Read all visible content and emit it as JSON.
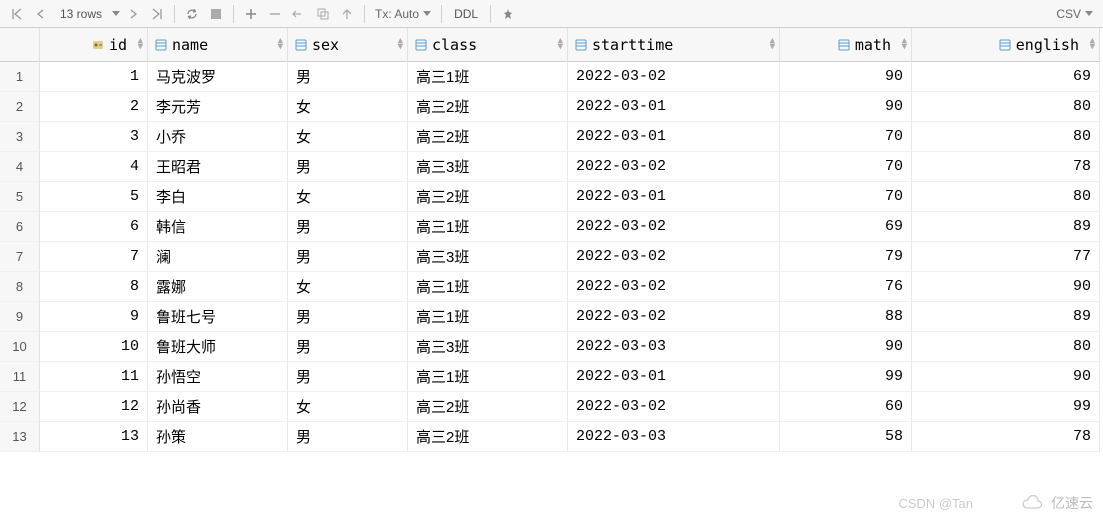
{
  "toolbar": {
    "row_count": "13 rows",
    "tx_label": "Tx: Auto",
    "ddl_label": "DDL",
    "export_label": "CSV"
  },
  "columns": [
    {
      "key": "id",
      "label": "id",
      "type": "pk",
      "align": "right"
    },
    {
      "key": "name",
      "label": "name",
      "type": "col",
      "align": "left"
    },
    {
      "key": "sex",
      "label": "sex",
      "type": "col",
      "align": "left"
    },
    {
      "key": "class",
      "label": "class",
      "type": "col",
      "align": "left"
    },
    {
      "key": "starttime",
      "label": "starttime",
      "type": "col",
      "align": "left"
    },
    {
      "key": "math",
      "label": "math",
      "type": "col",
      "align": "right"
    },
    {
      "key": "english",
      "label": "english",
      "type": "col",
      "align": "right"
    }
  ],
  "rows": [
    {
      "id": 1,
      "name": "马克波罗",
      "sex": "男",
      "class": "高三1班",
      "starttime": "2022-03-02",
      "math": 90,
      "english": 69
    },
    {
      "id": 2,
      "name": "李元芳",
      "sex": "女",
      "class": "高三2班",
      "starttime": "2022-03-01",
      "math": 90,
      "english": 80
    },
    {
      "id": 3,
      "name": "小乔",
      "sex": "女",
      "class": "高三2班",
      "starttime": "2022-03-01",
      "math": 70,
      "english": 80
    },
    {
      "id": 4,
      "name": "王昭君",
      "sex": "男",
      "class": "高三3班",
      "starttime": "2022-03-02",
      "math": 70,
      "english": 78
    },
    {
      "id": 5,
      "name": "李白",
      "sex": "女",
      "class": "高三2班",
      "starttime": "2022-03-01",
      "math": 70,
      "english": 80
    },
    {
      "id": 6,
      "name": "韩信",
      "sex": "男",
      "class": "高三1班",
      "starttime": "2022-03-02",
      "math": 69,
      "english": 89
    },
    {
      "id": 7,
      "name": "澜",
      "sex": "男",
      "class": "高三3班",
      "starttime": "2022-03-02",
      "math": 79,
      "english": 77
    },
    {
      "id": 8,
      "name": "露娜",
      "sex": "女",
      "class": "高三1班",
      "starttime": "2022-03-02",
      "math": 76,
      "english": 90
    },
    {
      "id": 9,
      "name": "鲁班七号",
      "sex": "男",
      "class": "高三1班",
      "starttime": "2022-03-02",
      "math": 88,
      "english": 89
    },
    {
      "id": 10,
      "name": "鲁班大师",
      "sex": "男",
      "class": "高三3班",
      "starttime": "2022-03-03",
      "math": 90,
      "english": 80
    },
    {
      "id": 11,
      "name": "孙悟空",
      "sex": "男",
      "class": "高三1班",
      "starttime": "2022-03-01",
      "math": 99,
      "english": 90
    },
    {
      "id": 12,
      "name": "孙尚香",
      "sex": "女",
      "class": "高三2班",
      "starttime": "2022-03-02",
      "math": 60,
      "english": 99
    },
    {
      "id": 13,
      "name": "孙策",
      "sex": "男",
      "class": "高三2班",
      "starttime": "2022-03-03",
      "math": 58,
      "english": 78
    }
  ],
  "watermark": {
    "csdn": "CSDN @Tan",
    "brand": "亿速云"
  }
}
